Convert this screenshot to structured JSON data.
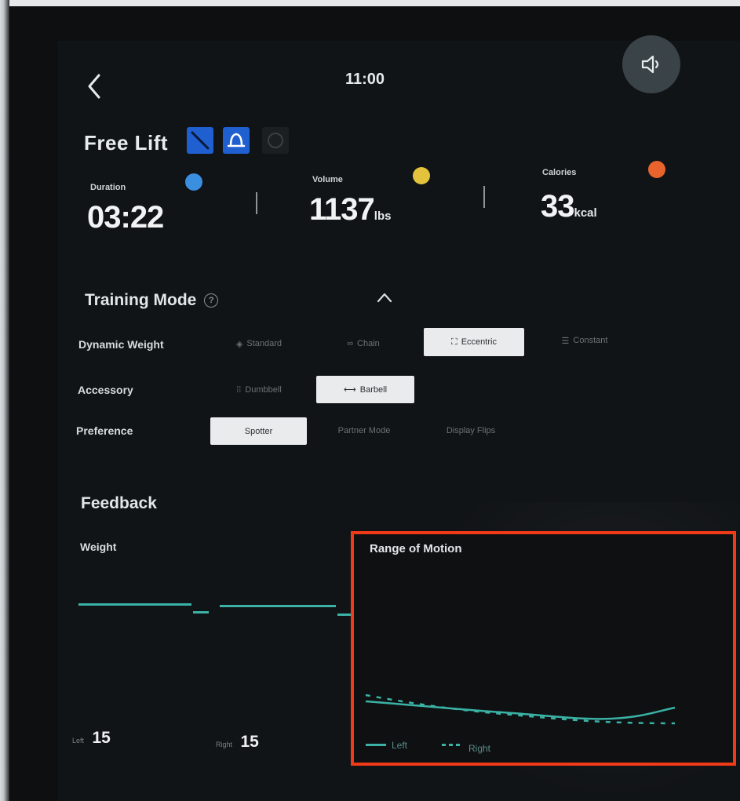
{
  "status_bar": {
    "time": "11:00"
  },
  "header": {
    "title": "Free Lift",
    "mode_icons": [
      {
        "name": "straight-bar-icon",
        "active": true
      },
      {
        "name": "bell-handle-icon",
        "active": true
      },
      {
        "name": "rope-icon",
        "active": false
      }
    ]
  },
  "stats": [
    {
      "label": "Duration",
      "value": "03:22",
      "unit": "",
      "icon": "clock-icon",
      "color": "#3b8fe0"
    },
    {
      "label": "Volume",
      "value": "1137",
      "unit": "lbs",
      "icon": "weight-icon",
      "color": "#e3c23c"
    },
    {
      "label": "Calories",
      "value": "33",
      "unit": "kcal",
      "icon": "flame-icon",
      "color": "#e8642c"
    }
  ],
  "training_mode": {
    "title": "Training Mode",
    "rows": [
      {
        "label": "Dynamic Weight",
        "options": [
          {
            "label": "Standard",
            "selected": false
          },
          {
            "label": "Chain",
            "selected": false
          },
          {
            "label": "Eccentric",
            "selected": true
          },
          {
            "label": "Constant",
            "selected": false
          }
        ]
      },
      {
        "label": "Accessory",
        "options": [
          {
            "label": "Dumbbell",
            "selected": false
          },
          {
            "label": "Barbell",
            "selected": true
          }
        ]
      },
      {
        "label": "Preference",
        "options": [
          {
            "label": "Spotter",
            "selected": true
          },
          {
            "label": "Partner Mode",
            "selected": false
          },
          {
            "label": "Display Flips",
            "selected": false
          }
        ]
      }
    ]
  },
  "feedback": {
    "title": "Feedback",
    "weight": {
      "title": "Weight",
      "left_label": "Left",
      "left_value": "15",
      "right_label": "Right",
      "right_value": "15"
    },
    "range_of_motion": {
      "title": "Range of Motion",
      "legend_left": "Left",
      "legend_right": "Right"
    }
  },
  "colors": {
    "accent_blue": "#1f5fd0",
    "series_teal": "#3bb2a5",
    "highlight_red": "#f13a17"
  }
}
